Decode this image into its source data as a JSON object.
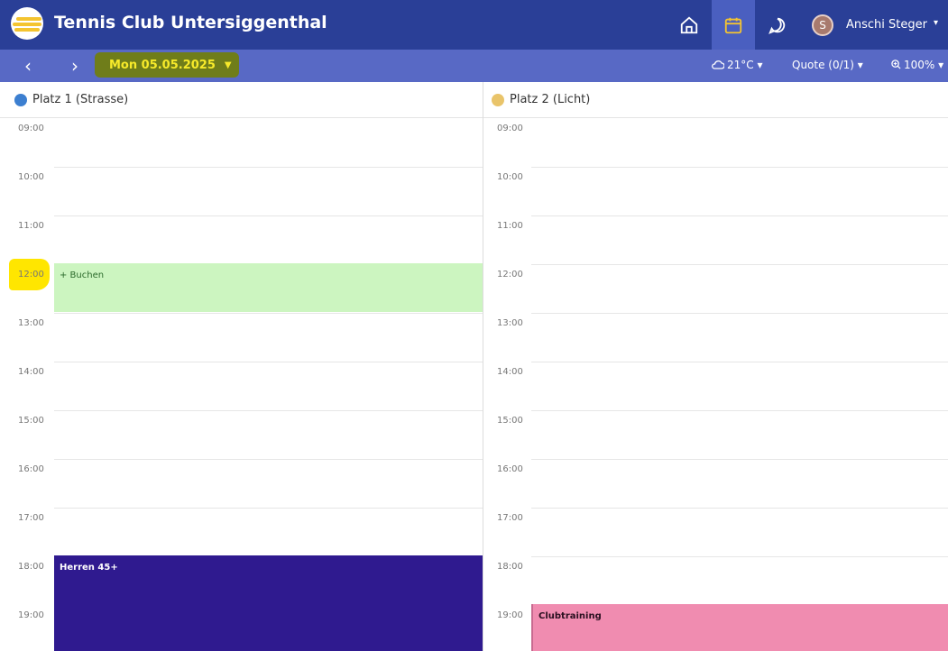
{
  "header": {
    "app_title": "Tennis Club Untersiggenthal",
    "nav_icons": [
      "home-icon",
      "calendar-icon",
      "chat-icon"
    ],
    "active_nav": "calendar-icon",
    "avatar_initial": "S",
    "user_name": "Anschi Steger",
    "user_caret": "▾"
  },
  "toolbar": {
    "prev": "‹",
    "next": "›",
    "date": "Mon 05.05.2025",
    "date_caret": "▼",
    "weather": "21°C ▾",
    "quota": "Quote (0/1) ▾",
    "zoom": "100% ▾"
  },
  "courts": [
    {
      "name": "Platz 1 (Strasse)",
      "color": "#3c7fd0"
    },
    {
      "name": "Platz 2 (Licht)",
      "color": "#e9c46a"
    }
  ],
  "hours": [
    "09:00",
    "10:00",
    "11:00",
    "12:00",
    "13:00",
    "14:00",
    "15:00",
    "16:00",
    "17:00",
    "18:00",
    "19:00"
  ],
  "hours_court1": [
    "09:00",
    "10:00",
    "11:00",
    "12:00",
    "13:00",
    "14:00",
    "15:00",
    "16:00",
    "17:00",
    "18:00",
    "19:00"
  ],
  "events": {
    "book": {
      "label": "+  Buchen",
      "color": "#ccf5c0",
      "text_color": "#2b6a2b"
    },
    "herren": {
      "label": "Herren 45+",
      "color": "#2f1a8f",
      "text_color": "#ffffff"
    },
    "clubtraining": {
      "label": "Clubtraining",
      "color": "#f08cb0",
      "text_color": "#2a1020"
    }
  }
}
